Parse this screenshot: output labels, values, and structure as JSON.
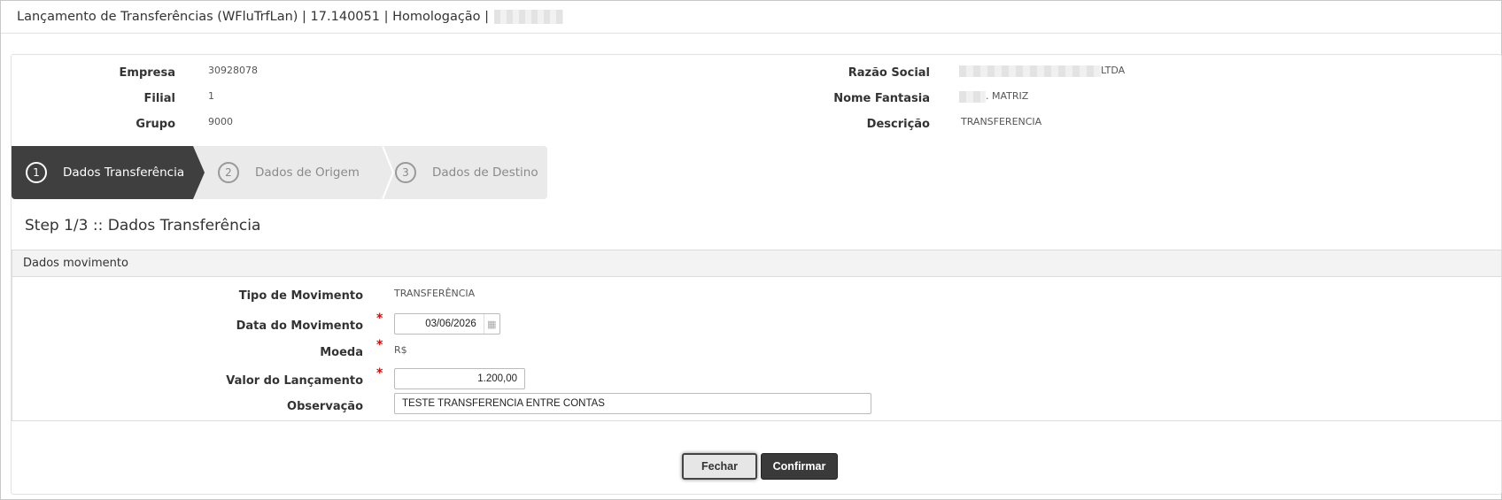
{
  "window": {
    "title": "Lançamento de Transferências (WFluTrfLan) | 17.140051 | Homologação |"
  },
  "header": {
    "empresa_label": "Empresa",
    "empresa_value": "30928078",
    "filial_label": "Filial",
    "filial_value": "1",
    "grupo_label": "Grupo",
    "grupo_value": "9000",
    "razao_label": "Razão Social",
    "razao_value": "LTDA",
    "fantasia_label": "Nome Fantasia",
    "fantasia_value": ". MATRIZ",
    "descricao_label": "Descrição",
    "descricao_value": "TRANSFERENCIA"
  },
  "wizard": {
    "steps": [
      {
        "number": "1",
        "label": "Dados Transferência",
        "active": true
      },
      {
        "number": "2",
        "label": "Dados de Origem",
        "active": false
      },
      {
        "number": "3",
        "label": "Dados de Destino",
        "active": false
      }
    ]
  },
  "step_heading": "Step 1/3 :: Dados Transferência",
  "section": {
    "title": "Dados movimento",
    "fields": {
      "tipo_label": "Tipo de Movimento",
      "tipo_value": "TRANSFERÊNCIA",
      "data_label": "Data do Movimento",
      "data_value": "03/06/2026",
      "moeda_label": "Moeda",
      "moeda_value": "R$",
      "valor_label": "Valor do Lançamento",
      "valor_value": "1.200,00",
      "obs_label": "Observação",
      "obs_value": "TESTE TRANSFERENCIA ENTRE CONTAS"
    },
    "required_marker": "*"
  },
  "buttons": {
    "fechar": "Fechar",
    "confirmar": "Confirmar"
  },
  "icons": {
    "calendar": "calendar-icon"
  },
  "colors": {
    "active_step": "#3f3f3f",
    "inactive_step": "#eaeaea",
    "required": "#ee0000"
  }
}
